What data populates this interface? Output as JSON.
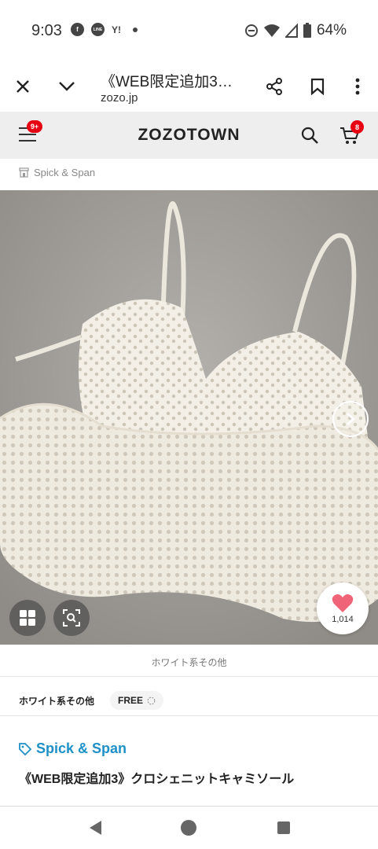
{
  "status_bar": {
    "time": "9:03",
    "icons": [
      "facebook-icon",
      "line-icon",
      "yahoo-icon",
      "dot-icon"
    ],
    "line_label": "LINE",
    "yahoo_label": "Y!",
    "battery": "64%"
  },
  "browser": {
    "title": "《WEB限定追加3…",
    "url": "zozo.jp"
  },
  "site_header": {
    "logo": "ZOZOTOWN",
    "menu_badge": "9+",
    "cart_badge": "8"
  },
  "breadcrumb": {
    "shop_label": "Spick & Span"
  },
  "product": {
    "likes": "1,014",
    "color_caption": "ホワイト系その他",
    "color_name": "ホワイト系その他",
    "size_chip": "FREE",
    "brand": "Spick & Span",
    "title": "《WEB限定追加3》クロシェニットキャミソール"
  },
  "colors": {
    "badge_red": "#e60012",
    "brand_blue": "#1e90c8",
    "heart_pink": "#f06478",
    "header_bg": "#eeeeee"
  }
}
